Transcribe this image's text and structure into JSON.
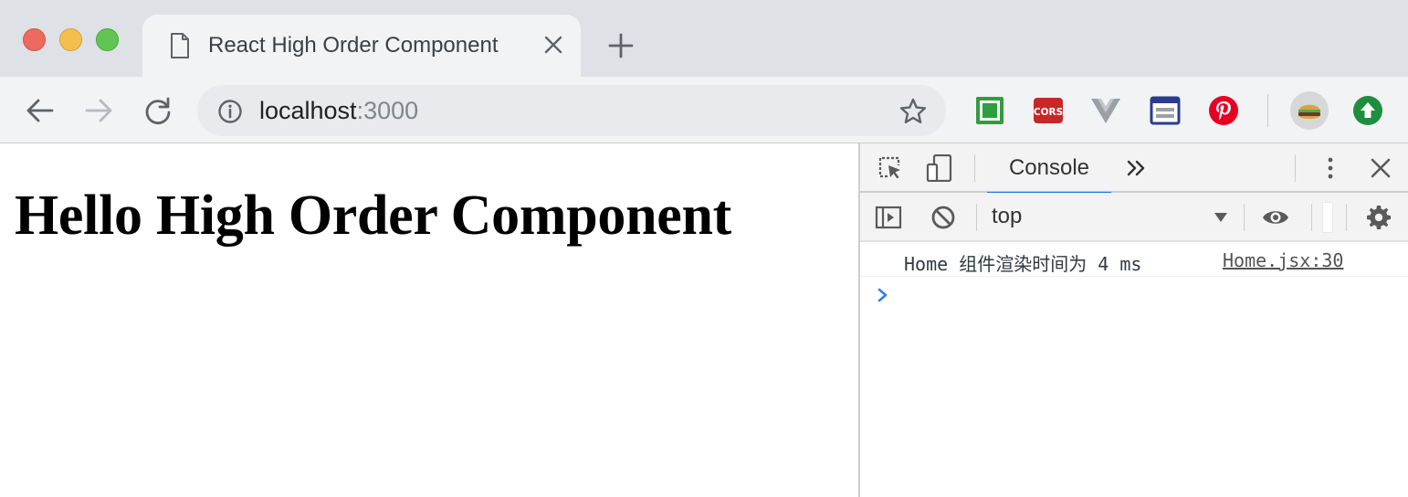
{
  "browser": {
    "tab": {
      "title": "React High Order Component"
    },
    "address_bar": {
      "host": "localhost",
      "port": ":3000"
    },
    "extensions": [
      {
        "name": "green-square-extension"
      },
      {
        "name": "cors-extension",
        "label": "CORS"
      },
      {
        "name": "vue-devtools-extension"
      },
      {
        "name": "window-extension"
      },
      {
        "name": "pinterest-extension"
      },
      {
        "name": "profile-avatar"
      },
      {
        "name": "update-extension"
      }
    ]
  },
  "page": {
    "heading": "Hello High Order Component"
  },
  "devtools": {
    "active_tab": "Console",
    "context": "top",
    "messages": [
      {
        "text": "Home 组件渲染时间为 4 ms",
        "source": "Home.jsx:30"
      }
    ]
  },
  "colors": {
    "tabstrip_bg": "#dee1e6",
    "toolbar_bg": "#f1f3f4",
    "accent_blue": "#1a73e8",
    "pinterest_red": "#e60023",
    "update_green": "#1e8e3e"
  }
}
